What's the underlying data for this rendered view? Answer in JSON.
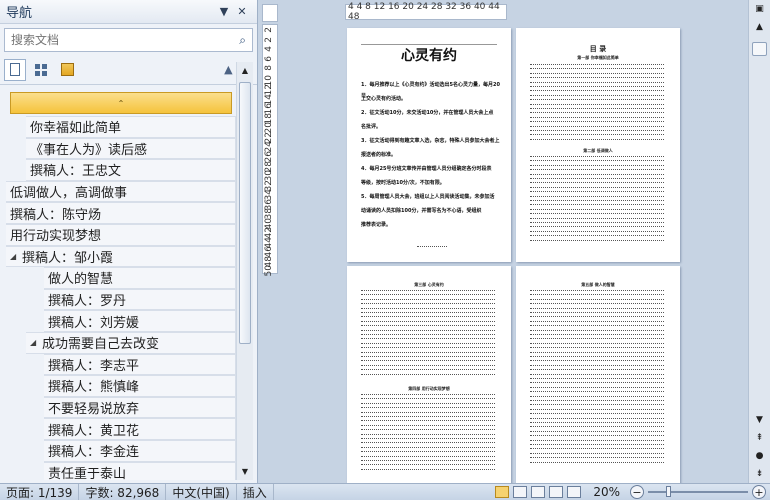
{
  "nav": {
    "title": "导航",
    "dropdown_icon": "▼",
    "close_icon": "✕",
    "search_placeholder": "搜索文档",
    "search_icon": "⌕",
    "prev_icon": "▲",
    "next_icon": "▼"
  },
  "tree": {
    "collapse_icon": "⌃",
    "items": [
      {
        "label": "你幸福如此简单",
        "level": 2
      },
      {
        "label": "《事在人为》读后感",
        "level": 2
      },
      {
        "label": "撰稿人：王忠文",
        "level": 2
      },
      {
        "label": "低调做人，高调做事",
        "level": 1
      },
      {
        "label": "撰稿人：陈守炀",
        "level": 1
      },
      {
        "label": "用行动实现梦想",
        "level": 1
      },
      {
        "label": "撰稿人：邹小霞",
        "level": 1,
        "expanded": true
      },
      {
        "label": "做人的智慧",
        "level": 3
      },
      {
        "label": "撰稿人：罗丹",
        "level": 3
      },
      {
        "label": "撰稿人：刘芳媛",
        "level": 3
      },
      {
        "label": "成功需要自己去改变",
        "level": 2,
        "expanded": true
      },
      {
        "label": "撰稿人：李志平",
        "level": 3
      },
      {
        "label": "撰稿人：熊慎峰",
        "level": 3
      },
      {
        "label": "不要轻易说放弃",
        "level": 3
      },
      {
        "label": "撰稿人：黄卫花",
        "level": 3
      },
      {
        "label": "撰稿人：李金连",
        "level": 3
      },
      {
        "label": "责任重于泰山",
        "level": 3
      }
    ]
  },
  "ruler": {
    "horizontal": "4  4  8  12 16 20 24 28 32 36 40 44 48",
    "vertical": [
      "2",
      "2",
      "4",
      "6",
      "8",
      "10",
      "12",
      "14",
      "16",
      "18",
      "20",
      "22",
      "24",
      "26",
      "28",
      "30",
      "32",
      "34",
      "36",
      "38",
      "40",
      "42",
      "44",
      "46",
      "48",
      "50"
    ]
  },
  "pages": {
    "p1_title": "心灵有约",
    "p1_paras": [
      "1．每月推荐以上《心灵有约》活动选出5名心灵力量，每月20日",
      "上交心灵有约活动。",
      "2．征文活动10分，未交活动10分，并在管理人员大会上点",
      "名批评。",
      "3．征文活动得到有趣文章入选，杂志，特殊人员参加大会者上",
      "报送者的标准。",
      "4．每月25号分班文章传并由管理人员分组确定各分时段表",
      "等级，按时活动10分/次，不加有限。",
      "5．每周管理人员大会，班组以上人员阅读活动集，未参加活",
      "动诵读的人员扣除100分，并需写名为不心语，受组织",
      "推荐表记录。"
    ],
    "p2_title": "目  录",
    "p2_sub1": "第一部  你幸福如此简单",
    "p2_sub2": "第二部  低调做人",
    "p3_sub1": "第三部  心灵有约",
    "p3_sub2": "第四部  用行动实现梦想",
    "p4_sub1": "第五部  做人的智慧"
  },
  "status": {
    "page": "页面: 1/139",
    "words": "字数: 82,968",
    "lang": "中文(中国)",
    "mode": "插入",
    "zoom": "20%",
    "zoom_minus": "−",
    "zoom_plus": "+"
  }
}
